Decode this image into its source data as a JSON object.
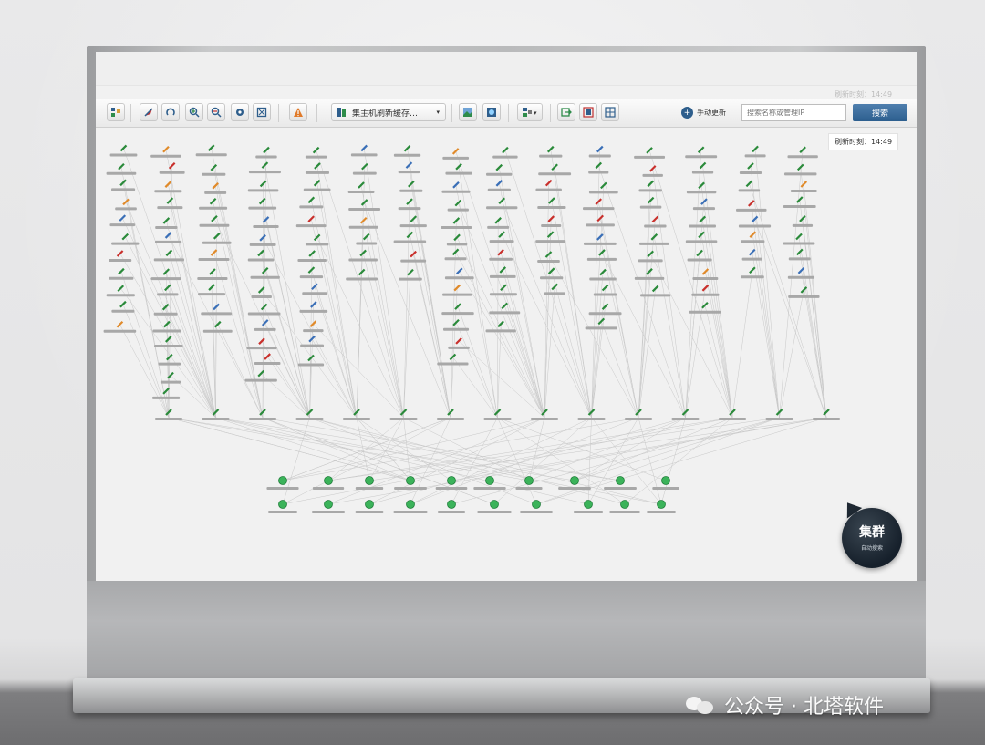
{
  "toolbar": {
    "dropdown_label": "集主机刷新缓存…",
    "auto_refresh_label": "手动更新",
    "search_placeholder": "搜索名称或管理IP",
    "search_button": "搜索"
  },
  "refresh_time_label": "刷新时刻：14:49",
  "cluster_button": {
    "title": "集群",
    "subtitle": "自动搜索"
  },
  "watermark": {
    "text": "公众号 · 北塔软件"
  },
  "colors": {
    "search_button": "#2f6193",
    "node_green": "#2a8a3a",
    "node_red": "#c9302c",
    "node_orange": "#e08a2a",
    "node_blue": "#3a6fb7",
    "edge": "#c8c8c8"
  },
  "icons": [
    "topology-icon",
    "pointer-icon",
    "undo-icon",
    "zoom-in-icon",
    "zoom-out-icon",
    "settings-icon",
    "fit-icon",
    "alert-icon",
    "image-icon",
    "image-export-icon",
    "layout-icon",
    "export-icon",
    "refresh-icon",
    "grid-icon"
  ]
}
